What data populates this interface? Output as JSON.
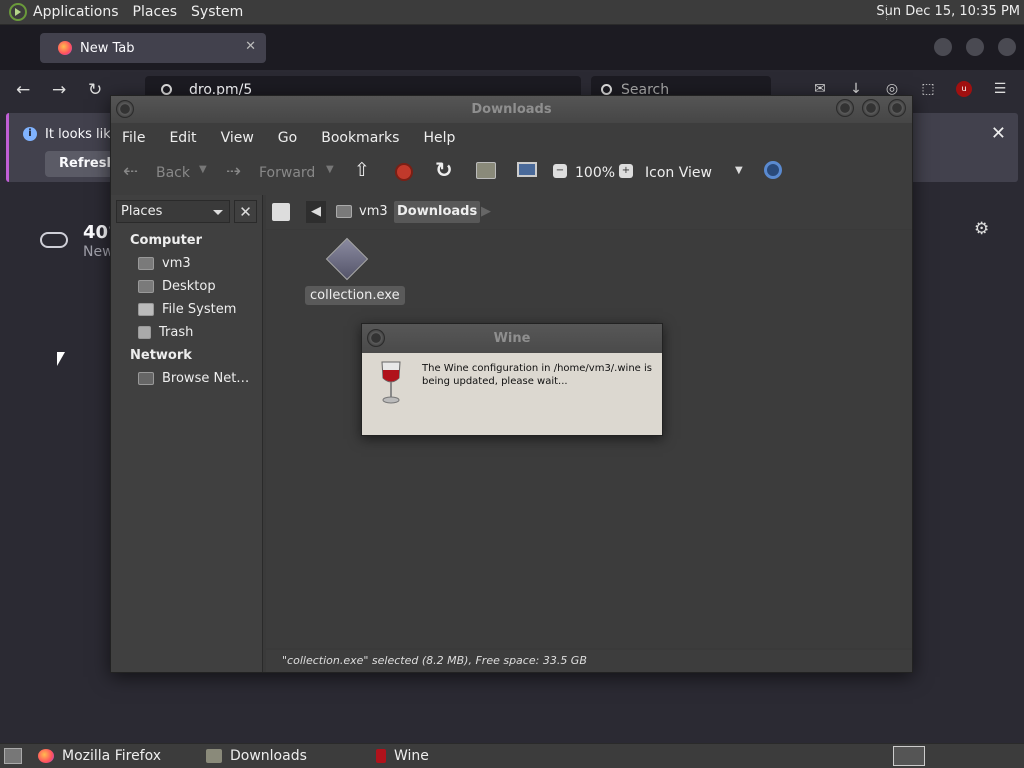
{
  "top_panel": {
    "menus": [
      "Applications",
      "Places",
      "System"
    ],
    "clock": "Sun Dec 15, 10:35 PM"
  },
  "firefox": {
    "tab_title": "New Tab",
    "url_text": "dro.pm/5",
    "search_placeholder": "Search",
    "notice_text": "It looks like",
    "refresh_label": "Refresh F",
    "weather_temp": "40°",
    "weather_location": "New"
  },
  "nautilus": {
    "title": "Downloads",
    "menus": [
      "File",
      "Edit",
      "View",
      "Go",
      "Bookmarks",
      "Help"
    ],
    "toolbar": {
      "back": "Back",
      "forward": "Forward",
      "zoom": "100%",
      "view_mode": "Icon View"
    },
    "sidebar": {
      "selector": "Places",
      "computer_heading": "Computer",
      "computer_items": [
        "vm3",
        "Desktop",
        "File System",
        "Trash"
      ],
      "network_heading": "Network",
      "network_items": [
        "Browse Net…"
      ]
    },
    "breadcrumbs": [
      "vm3",
      "Downloads"
    ],
    "files": [
      {
        "name": "collection.exe"
      }
    ],
    "status": "\"collection.exe\" selected (8.2 MB), Free space: 33.5 GB"
  },
  "wine_dialog": {
    "title": "Wine",
    "message": "The Wine configuration in /home/vm3/.wine is being updated, please wait..."
  },
  "taskbar": {
    "items": [
      "Mozilla Firefox",
      "Downloads",
      "Wine"
    ]
  }
}
